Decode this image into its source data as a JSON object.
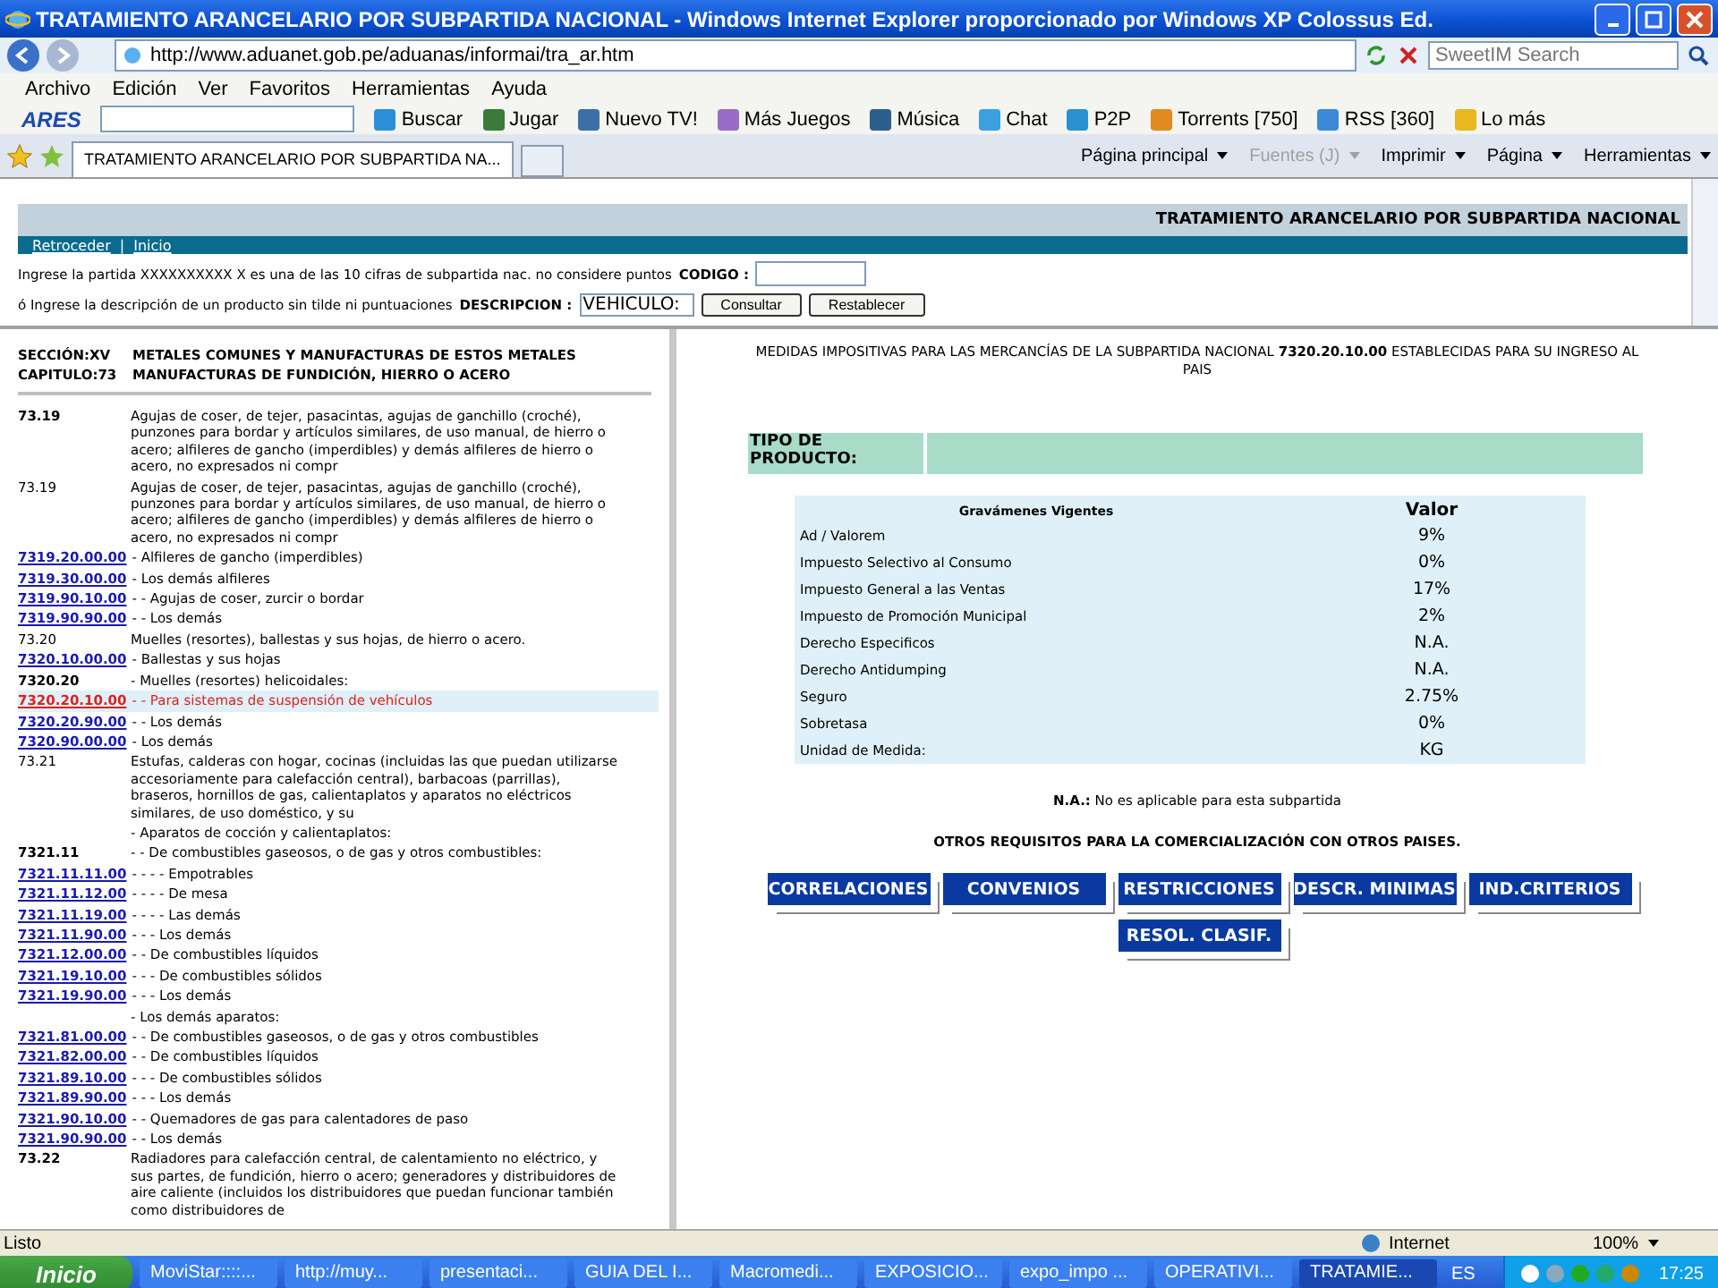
{
  "window": {
    "title": "TRATAMIENTO ARANCELARIO POR SUBPARTIDA NACIONAL - Windows Internet Explorer proporcionado por Windows XP Colossus Ed."
  },
  "address": {
    "url": "http://www.aduanet.gob.pe/aduanas/informai/tra_ar.htm"
  },
  "search": {
    "placeholder": "SweetIM Search"
  },
  "menu": [
    "Archivo",
    "Edición",
    "Ver",
    "Favoritos",
    "Herramientas",
    "Ayuda"
  ],
  "toolbar": {
    "brand": "ARES",
    "items": [
      {
        "label": "Buscar",
        "color": "#2a8fd8"
      },
      {
        "label": "Jugar",
        "color": "#3a7a3a"
      },
      {
        "label": "Nuevo TV!",
        "color": "#3c6fa8"
      },
      {
        "label": "Más Juegos",
        "color": "#9a6bc8"
      },
      {
        "label": "Música",
        "color": "#2b5e8c"
      },
      {
        "label": "Chat",
        "color": "#3aa0e0"
      },
      {
        "label": "P2P",
        "color": "#2a90d0"
      },
      {
        "label": "Torrents [750]",
        "color": "#e08a20"
      },
      {
        "label": "RSS [360]",
        "color": "#3a8ad8"
      },
      {
        "label": "Lo más",
        "color": "#e8b820"
      }
    ]
  },
  "tabs": [
    {
      "label": "TRATAMIENTO ARANCELARIO POR SUBPARTIDA NA...",
      "selected": true
    }
  ],
  "commands": [
    {
      "label": "Página principal",
      "disabled": false
    },
    {
      "label": "Fuentes (J)",
      "disabled": true
    },
    {
      "label": "Imprimir",
      "disabled": false
    },
    {
      "label": "Página",
      "disabled": false
    },
    {
      "label": "Herramientas",
      "disabled": false
    }
  ],
  "page": {
    "title": "TRATAMIENTO ARANCELARIO POR SUBPARTIDA NACIONAL",
    "nav": [
      "Retroceder",
      "Inicio"
    ],
    "nav_separator": "|",
    "form": {
      "line1": "Ingrese la partida XXXXXXXXXX X es una de las 10 cifras de subpartida nac. no considere puntos",
      "codigo_label": "CODIGO :",
      "line2": "ó Ingrese la descripción de un producto sin tilde ni puntuaciones",
      "descripcion_label": "DESCRIPCION :",
      "descripcion_value": "VEHICULO:",
      "buttons": [
        "Consultar",
        "Restablecer"
      ]
    }
  },
  "left": {
    "section_label": "SECCIÓN:XV",
    "section_name": "METALES COMUNES Y MANUFACTURAS DE ESTOS METALES",
    "chapter_label": "CAPITULO:73",
    "chapter_name": "MANUFACTURAS DE FUNDICIÓN, HIERRO O ACERO",
    "rows": [
      {
        "kind": "heading",
        "code": "73.19",
        "desc": "Agujas de coser, de tejer, pasacintas, agujas de ganchillo (croché), punzones para bordar y artículos similares, de uso manual, de hierro o acero; alfileres de gancho (imperdibles) y demás alfileres de hierro o acero, no expresados ni compr",
        "selected": false
      },
      {
        "kind": "plain",
        "code": "73.19",
        "desc": "Agujas de coser, de tejer, pasacintas, agujas de ganchillo (croché), punzones para bordar y artículos similares, de uso manual, de hierro o acero; alfileres de gancho (imperdibles) y demás alfileres de hierro o acero, no expresados ni compr",
        "selected": false
      },
      {
        "kind": "link",
        "code": "7319.20.00.00",
        "desc": "- Alfileres de gancho (imperdibles)",
        "selected": false
      },
      {
        "kind": "link",
        "code": "7319.30.00.00",
        "desc": "- Los demás alfileres",
        "selected": false
      },
      {
        "kind": "link",
        "code": "7319.90.10.00",
        "desc": "- - Agujas de coser, zurcir o bordar",
        "selected": false
      },
      {
        "kind": "link",
        "code": "7319.90.90.00",
        "desc": "- - Los demás",
        "selected": false
      },
      {
        "kind": "plain",
        "code": "73.20",
        "desc": "Muelles (resortes), ballestas y sus hojas, de hierro o acero.",
        "selected": false
      },
      {
        "kind": "link",
        "code": "7320.10.00.00",
        "desc": "- Ballestas y sus hojas",
        "selected": false
      },
      {
        "kind": "heading",
        "code": "7320.20",
        "desc": "- Muelles (resortes) helicoidales:",
        "selected": false
      },
      {
        "kind": "link",
        "code": "7320.20.10.00",
        "desc": "- - Para sistemas de suspensión de vehículos",
        "selected": true
      },
      {
        "kind": "link",
        "code": "7320.20.90.00",
        "desc": "- - Los demás",
        "selected": false
      },
      {
        "kind": "link",
        "code": "7320.90.00.00",
        "desc": "- Los demás",
        "selected": false
      },
      {
        "kind": "plain",
        "code": "73.21",
        "desc": "Estufas, calderas con hogar, cocinas (incluidas las que puedan utilizarse accesoriamente para calefacción central), barbacoas (parrillas), braseros, hornillos de gas, calientaplatos y aparatos no eléctricos similares, de uso doméstico, y su",
        "selected": false
      },
      {
        "kind": "plain",
        "code": "",
        "desc": "- Aparatos de cocción y calientaplatos:",
        "selected": false
      },
      {
        "kind": "heading",
        "code": "7321.11",
        "desc": "- - De combustibles gaseosos, o de gas y otros combustibles:",
        "selected": false
      },
      {
        "kind": "link",
        "code": "7321.11.11.00",
        "desc": "- - - - Empotrables",
        "selected": false
      },
      {
        "kind": "link",
        "code": "7321.11.12.00",
        "desc": "- - - - De mesa",
        "selected": false
      },
      {
        "kind": "link",
        "code": "7321.11.19.00",
        "desc": "- - - - Las demás",
        "selected": false
      },
      {
        "kind": "link",
        "code": "7321.11.90.00",
        "desc": "- - - Los demás",
        "selected": false
      },
      {
        "kind": "link",
        "code": "7321.12.00.00",
        "desc": "- - De combustibles líquidos",
        "selected": false
      },
      {
        "kind": "link",
        "code": "7321.19.10.00",
        "desc": "- - - De combustibles sólidos",
        "selected": false
      },
      {
        "kind": "link",
        "code": "7321.19.90.00",
        "desc": "- - - Los demás",
        "selected": false
      },
      {
        "kind": "plain",
        "code": "",
        "desc": "- Los demás aparatos:",
        "selected": false
      },
      {
        "kind": "link",
        "code": "7321.81.00.00",
        "desc": "- - De combustibles gaseosos, o de gas y otros combustibles",
        "selected": false
      },
      {
        "kind": "link",
        "code": "7321.82.00.00",
        "desc": "- - De combustibles líquidos",
        "selected": false
      },
      {
        "kind": "link",
        "code": "7321.89.10.00",
        "desc": "- - - De combustibles sólidos",
        "selected": false
      },
      {
        "kind": "link",
        "code": "7321.89.90.00",
        "desc": "- - - Los demás",
        "selected": false
      },
      {
        "kind": "link",
        "code": "7321.90.10.00",
        "desc": "- - Quemadores de gas para calentadores de paso",
        "selected": false
      },
      {
        "kind": "link",
        "code": "7321.90.90.00",
        "desc": "- - Los demás",
        "selected": false
      },
      {
        "kind": "heading",
        "code": "73.22",
        "desc": "Radiadores para calefacción central, de calentamiento no eléctrico, y sus partes, de fundición, hierro o acero; generadores y distribuidores de aire caliente (incluidos los distribuidores que puedan funcionar también como distribuidores de",
        "selected": false
      }
    ]
  },
  "right": {
    "intro": "MEDIDAS IMPOSITIVAS PARA LAS MERCANCÍAS DE LA SUBPARTIDA NACIONAL **7320.20.10.00** ESTABLECIDAS PARA SU INGRESO AL PAIS",
    "tipo_label": "TIPO DE PRODUCTO:",
    "table": {
      "columns": [
        "Gravámenes Vigentes",
        "Valor"
      ],
      "rows": [
        {
          "name": "Ad / Valorem",
          "value": "9%"
        },
        {
          "name": "Impuesto Selectivo al Consumo",
          "value": "0%"
        },
        {
          "name": "Impuesto General a las Ventas",
          "value": "17%"
        },
        {
          "name": "Impuesto de Promoción Municipal",
          "value": "2%"
        },
        {
          "name": "Derecho Especificos",
          "value": "N.A."
        },
        {
          "name": "Derecho Antidumping",
          "value": "N.A."
        },
        {
          "name": "Seguro",
          "value": "2.75%"
        },
        {
          "name": "Sobretasa",
          "value": "0%"
        },
        {
          "name": "Unidad de Medida:",
          "value": "KG"
        }
      ]
    },
    "note": "**N.A.:** No es aplicable para esta subpartida",
    "others_title": "OTROS REQUISITOS PARA LA COMERCIALIZACIÓN CON OTROS PAISES.",
    "buttons": [
      "CORRELACIONES",
      "CONVENIOS",
      "RESTRICCIONES",
      "DESCR. MINIMAS",
      "IND.CRITERIOS",
      "RESOL. CLASIF."
    ]
  },
  "status_bar": {
    "text": "Listo",
    "zone": "Internet",
    "zoom": "100%"
  },
  "taskbar": {
    "start": "Inicio",
    "items": [
      {
        "label": "MoviStar::::...",
        "selected": false
      },
      {
        "label": "http://muy...",
        "selected": false
      },
      {
        "label": "presentaci...",
        "selected": false
      },
      {
        "label": "GUIA DEL I...",
        "selected": false
      },
      {
        "label": "Macromedi...",
        "selected": false
      },
      {
        "label": "EXPOSICIO...",
        "selected": false
      },
      {
        "label": "expo_impo ...",
        "selected": false
      },
      {
        "label": "OPERATIVI...",
        "selected": false
      },
      {
        "label": "TRATAMIE...",
        "selected": true
      }
    ],
    "language": "ES",
    "clock": "17:25"
  }
}
